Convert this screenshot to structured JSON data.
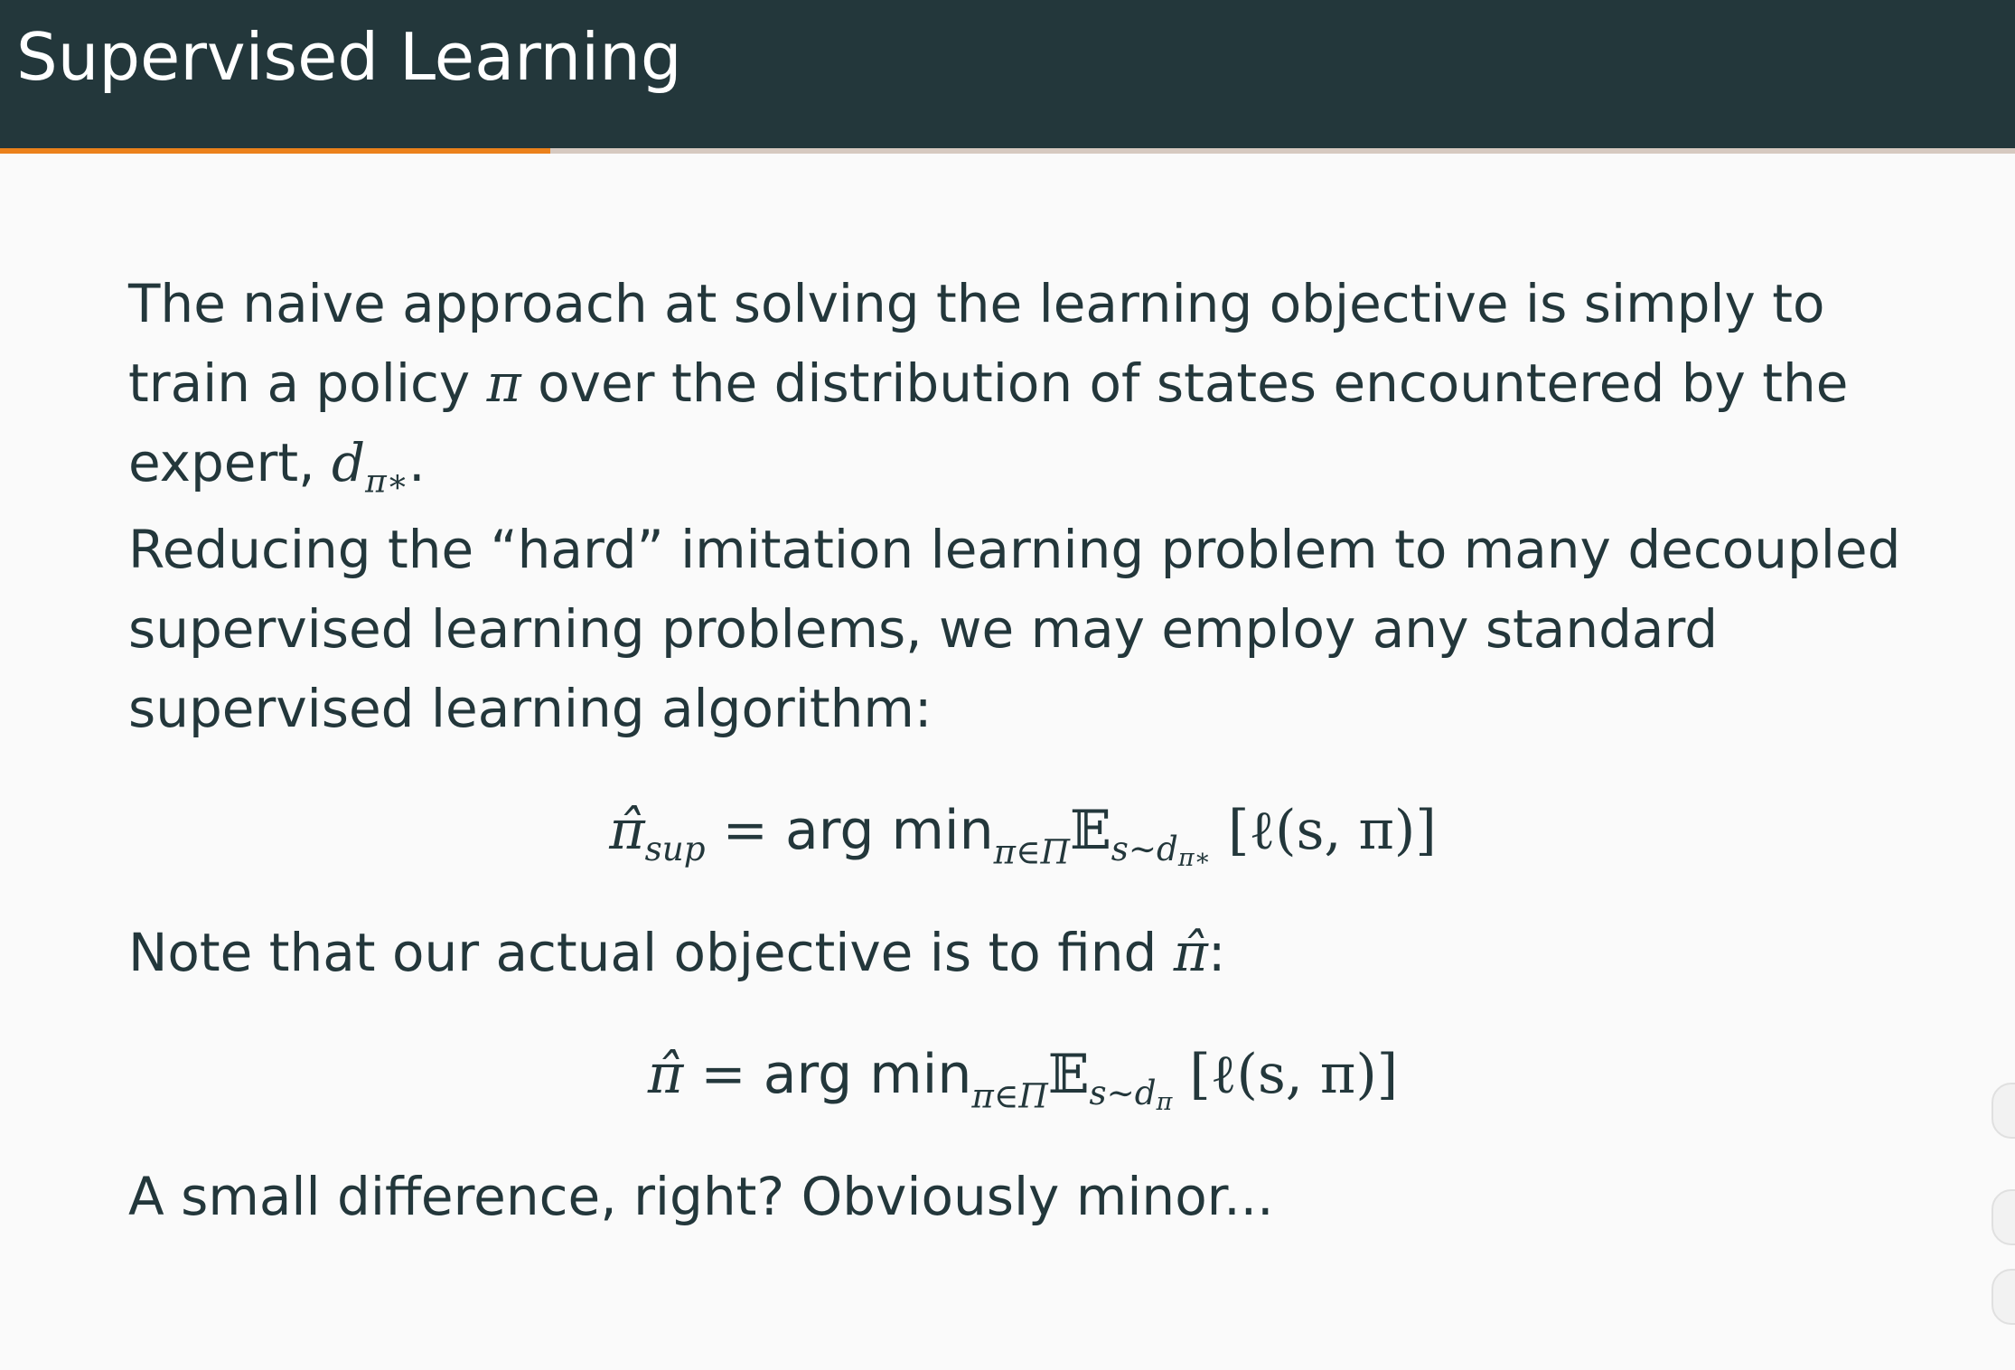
{
  "slide": {
    "title": "Supervised Learning",
    "progress": 0.273
  },
  "body": {
    "p1_text_a": "The naive approach at solving the learning objective is simply to train a policy ",
    "p1_pi": "π",
    "p1_text_b": " over the distribution of states encountered by the expert, ",
    "p1_d": "d",
    "p1_d_sub": "π∗",
    "p1_end": ".",
    "p2_text": "Reducing the “hard” imitation learning problem to many decoupled supervised learning problems, we may employ any standard supervised learning algorithm:",
    "eq1": {
      "lhs": "π̂",
      "lhs_sub": "sup",
      "equals": " = ",
      "argmin": "arg min",
      "argmin_sub": "π∈Π",
      "expect": "𝔼",
      "expect_sub": "s∼d",
      "expect_sub_sub": "π∗",
      "rhs": " [ℓ(s, π)]"
    },
    "p3_text": "Note that our actual objective is to find ",
    "p3_pihat": "π̂",
    "p3_end": ":",
    "eq2": {
      "lhs": "π̂",
      "equals": " = ",
      "argmin": "arg min",
      "argmin_sub": "π∈Π",
      "expect": "𝔼",
      "expect_sub": "s∼d",
      "expect_sub_sub": "π",
      "rhs": " [ℓ(s, π)]"
    },
    "p4_text": "A small difference, right? Obviously minor..."
  }
}
